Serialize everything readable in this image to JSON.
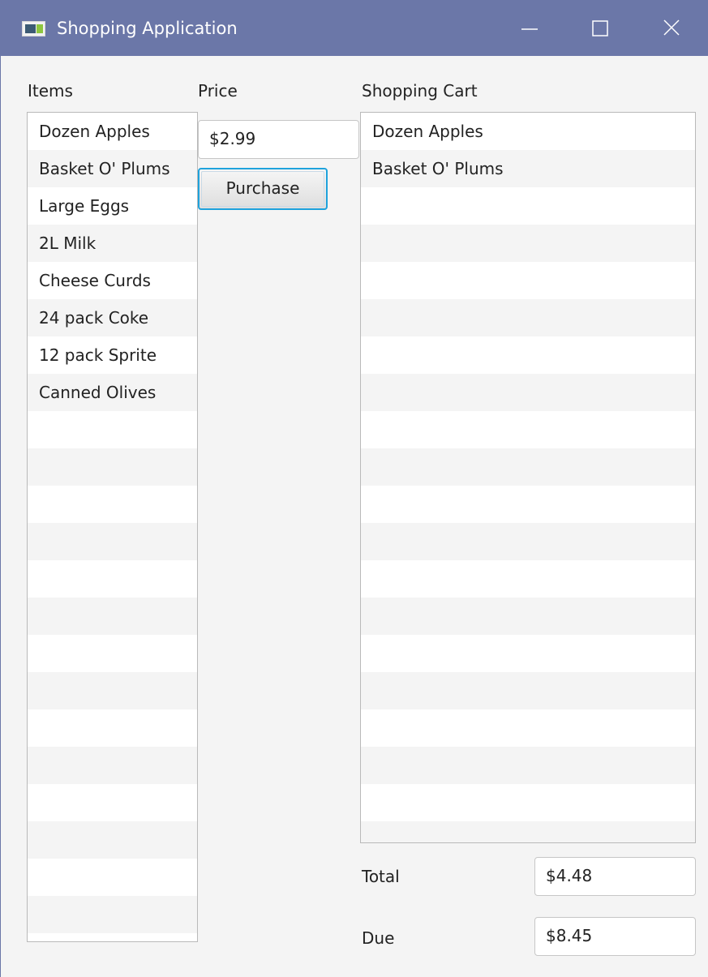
{
  "window": {
    "title": "Shopping Application",
    "icon": "java-app-icon",
    "controls": {
      "minimize": "minimize-icon",
      "maximize": "maximize-icon",
      "close": "close-icon"
    }
  },
  "items": {
    "label": "Items",
    "list": [
      {
        "label": "Dozen Apples"
      },
      {
        "label": "Basket O' Plums"
      },
      {
        "label": "Large Eggs"
      },
      {
        "label": "2L Milk"
      },
      {
        "label": "Cheese Curds"
      },
      {
        "label": "24 pack Coke"
      },
      {
        "label": "12 pack Sprite"
      },
      {
        "label": "Canned Olives"
      }
    ]
  },
  "price": {
    "label": "Price",
    "value": "$2.99"
  },
  "purchase_button": {
    "label": "Purchase"
  },
  "cart": {
    "label": "Shopping Cart",
    "list": [
      {
        "label": "Dozen Apples"
      },
      {
        "label": "Basket O' Plums"
      }
    ]
  },
  "totals": {
    "total_label": "Total",
    "total_value": "$4.48",
    "due_label": "Due",
    "due_value": "$8.45"
  },
  "colors": {
    "titlebar": "#6b77a8",
    "focus_border": "#1ea2dc",
    "background": "#f4f4f4"
  }
}
